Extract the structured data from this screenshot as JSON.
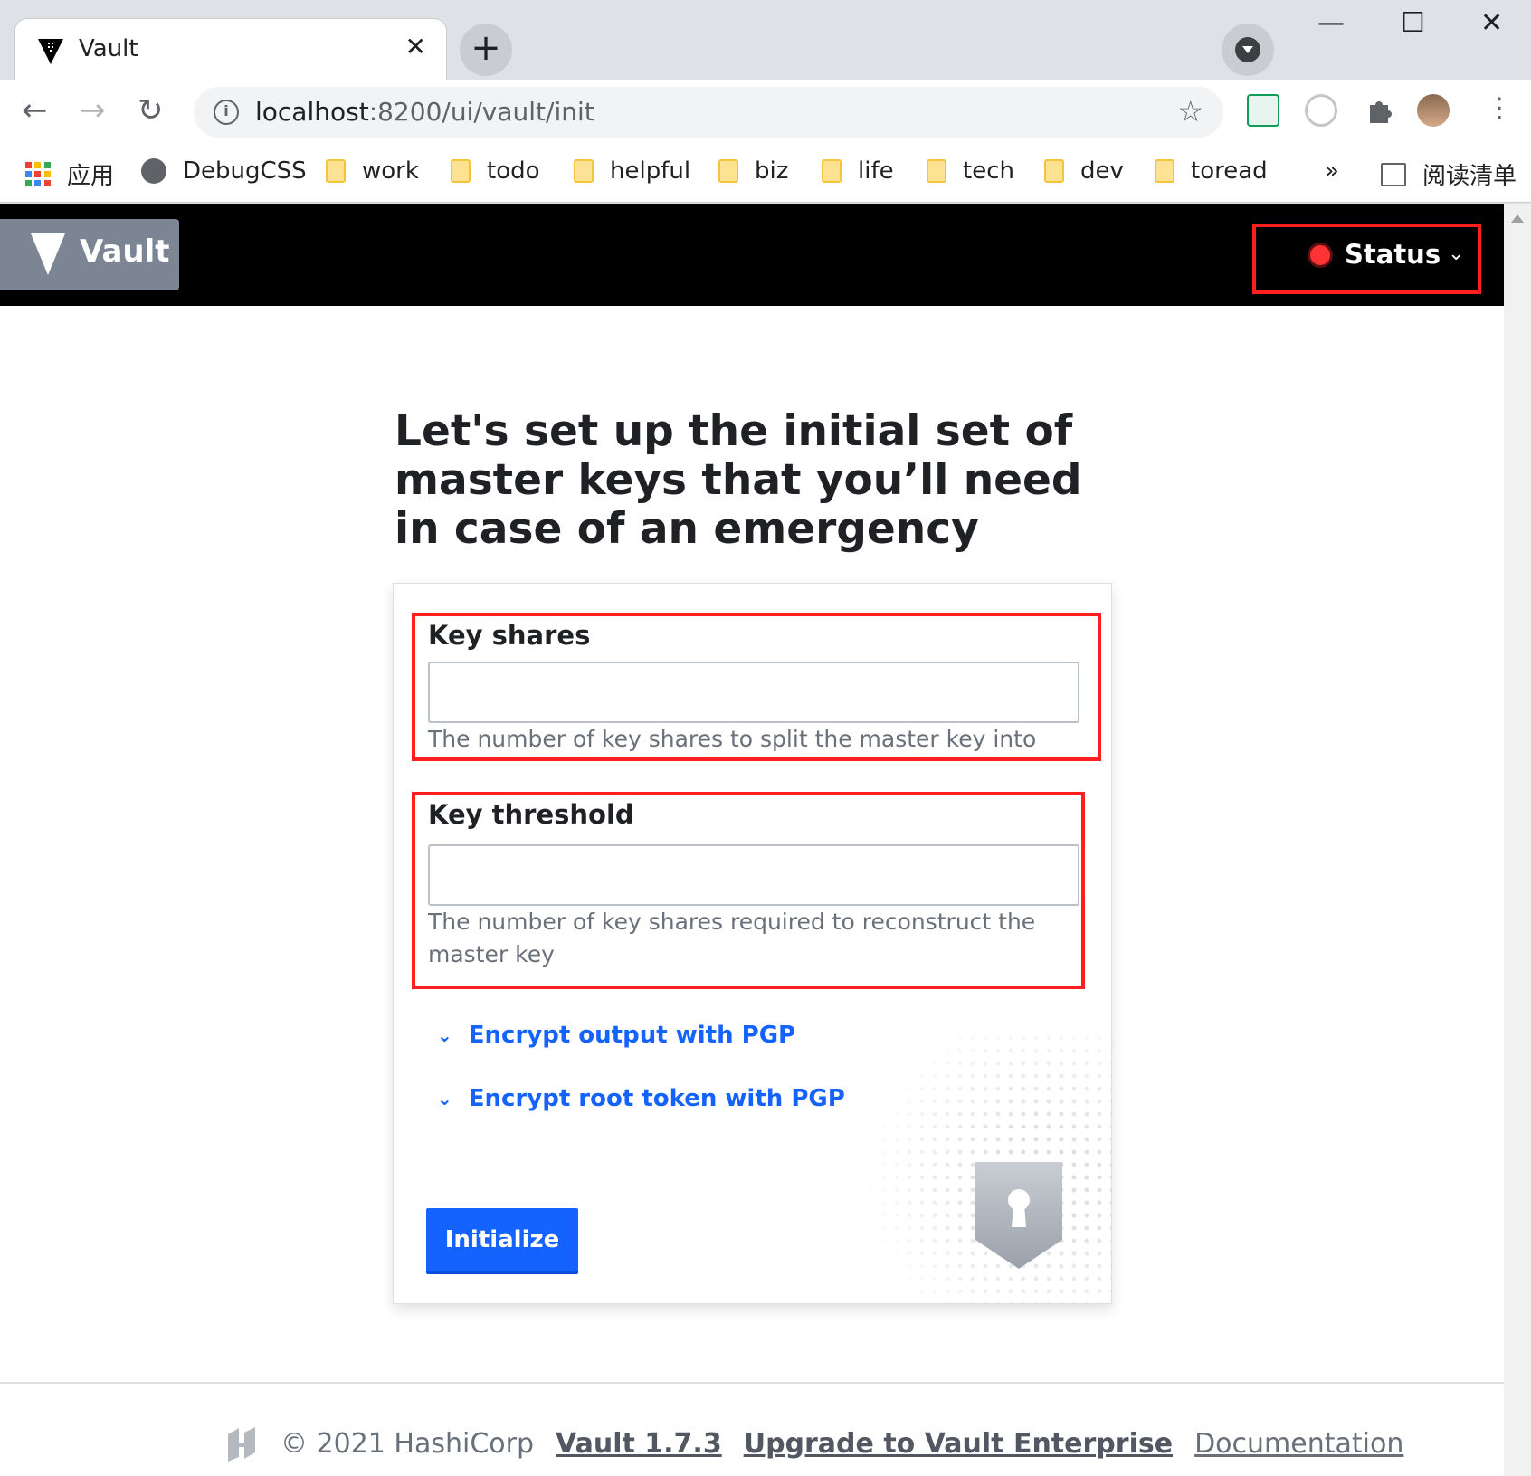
{
  "browser": {
    "tab_title": "Vault",
    "tab_close": "✕",
    "new_tab": "+",
    "url_host": "localhost",
    "url_path": ":8200/ui/vault/init",
    "star": "☆",
    "back": "←",
    "forward": "→",
    "reload": "↻",
    "minimize": "—",
    "maximize": "☐",
    "close": "✕",
    "menu": "⋮",
    "bookmarks": [
      "DebugCSS",
      "work",
      "todo",
      "helpful",
      "biz",
      "life",
      "tech",
      "dev",
      "toread"
    ],
    "apps_label": "应用",
    "more": "»",
    "reading_list": "阅读清单"
  },
  "nav": {
    "brand": "Vault",
    "status_label": "Status",
    "status_chevron": "⌄"
  },
  "main": {
    "heading": "Let's set up the initial set of master keys that you’ll need in case of an emergency",
    "key_shares": {
      "label": "Key shares",
      "value": "",
      "help": "The number of key shares to split the master key into"
    },
    "key_threshold": {
      "label": "Key threshold",
      "value": "",
      "help": "The number of key shares required to reconstruct the master key"
    },
    "toggles": [
      {
        "label": "Encrypt output with PGP",
        "chevron": "⌄"
      },
      {
        "label": "Encrypt root token with PGP",
        "chevron": "⌄"
      }
    ],
    "submit_label": "Initialize"
  },
  "footer": {
    "copyright": "© 2021 HashiCorp",
    "version_link": "Vault 1.7.3",
    "upgrade_link": "Upgrade to Vault Enterprise",
    "docs_link": "Documentation"
  },
  "colors": {
    "accent": "#1563ff",
    "nav_bg": "#000000",
    "brand_bg": "#7c8593",
    "highlight": "#ff1f1f",
    "status_dot": "#ff3333"
  }
}
